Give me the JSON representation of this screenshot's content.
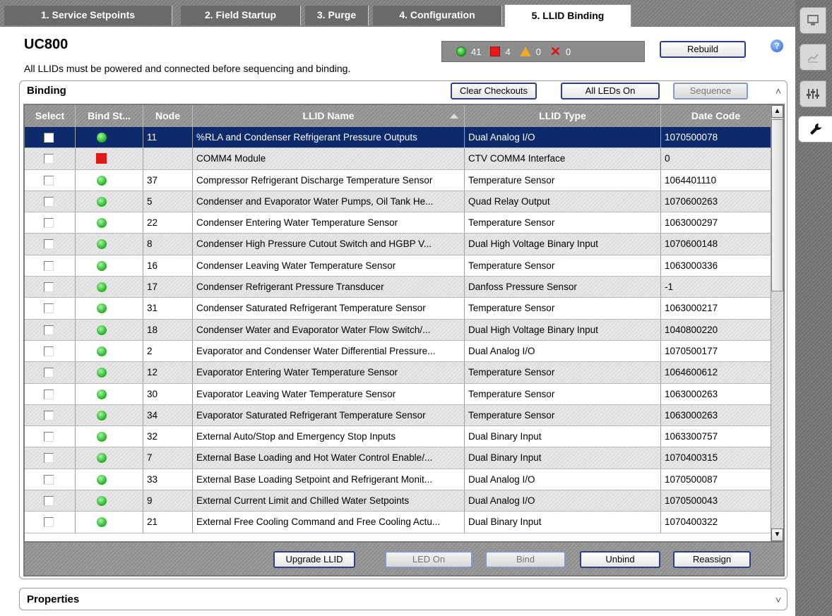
{
  "tabs": [
    {
      "label": "1. Service Setpoints"
    },
    {
      "label": "2. Field Startup"
    },
    {
      "label": "3. Purge"
    },
    {
      "label": "4. Configuration"
    },
    {
      "label": "5. LLID Binding"
    }
  ],
  "header": {
    "title": "UC800",
    "subtitle": "All LLIDs must be powered and connected before sequencing and binding.",
    "status": {
      "ok": "41",
      "error": "4",
      "warning": "0",
      "missing": "0"
    },
    "rebuild_label": "Rebuild",
    "help_glyph": "?"
  },
  "binding": {
    "title": "Binding",
    "collapse_glyph": "˄",
    "buttons": {
      "clear_checkouts": "Clear Checkouts",
      "all_leds_on": "All LEDs On",
      "sequence": "Sequence"
    },
    "columns": [
      "Select",
      "Bind St...",
      "Node",
      "LLID Name",
      "LLID Type",
      "Date Code"
    ],
    "rows": [
      {
        "status": "ok",
        "node": "11",
        "name": "%RLA and Condenser Refrigerant Pressure Outputs",
        "type": "Dual Analog I/O",
        "date": "1070500078",
        "selected": true
      },
      {
        "status": "error",
        "node": "",
        "name": "COMM4 Module",
        "type": "CTV COMM4 Interface",
        "date": "0"
      },
      {
        "status": "ok",
        "node": "37",
        "name": "Compressor Refrigerant Discharge Temperature Sensor",
        "type": "Temperature Sensor",
        "date": "1064401110"
      },
      {
        "status": "ok",
        "node": "5",
        "name": "Condenser and Evaporator Water Pumps, Oil Tank He...",
        "type": "Quad Relay Output",
        "date": "1070600263"
      },
      {
        "status": "ok",
        "node": "22",
        "name": "Condenser Entering Water Temperature Sensor",
        "type": "Temperature Sensor",
        "date": "1063000297"
      },
      {
        "status": "ok",
        "node": "8",
        "name": "Condenser High Pressure Cutout Switch and HGBP V...",
        "type": "Dual High Voltage Binary Input",
        "date": "1070600148"
      },
      {
        "status": "ok",
        "node": "16",
        "name": "Condenser Leaving Water Temperature Sensor",
        "type": "Temperature Sensor",
        "date": "1063000336"
      },
      {
        "status": "ok",
        "node": "17",
        "name": "Condenser Refrigerant Pressure Transducer",
        "type": "Danfoss Pressure Sensor",
        "date": "-1"
      },
      {
        "status": "ok",
        "node": "31",
        "name": "Condenser Saturated Refrigerant Temperature Sensor",
        "type": "Temperature Sensor",
        "date": "1063000217"
      },
      {
        "status": "ok",
        "node": "18",
        "name": "Condenser Water and Evaporator Water Flow Switch/...",
        "type": "Dual High Voltage Binary Input",
        "date": "1040800220"
      },
      {
        "status": "ok",
        "node": "2",
        "name": "Evaporator and Condenser Water Differential Pressure...",
        "type": "Dual Analog I/O",
        "date": "1070500177"
      },
      {
        "status": "ok",
        "node": "12",
        "name": "Evaporator Entering Water Temperature Sensor",
        "type": "Temperature Sensor",
        "date": "1064600612"
      },
      {
        "status": "ok",
        "node": "30",
        "name": "Evaporator Leaving Water Temperature Sensor",
        "type": "Temperature Sensor",
        "date": "1063000263"
      },
      {
        "status": "ok",
        "node": "34",
        "name": "Evaporator Saturated Refrigerant Temperature Sensor",
        "type": "Temperature Sensor",
        "date": "1063000263"
      },
      {
        "status": "ok",
        "node": "32",
        "name": "External Auto/Stop and Emergency Stop Inputs",
        "type": "Dual Binary Input",
        "date": "1063300757"
      },
      {
        "status": "ok",
        "node": "7",
        "name": "External Base Loading and Hot Water Control Enable/...",
        "type": "Dual Binary Input",
        "date": "1070400315"
      },
      {
        "status": "ok",
        "node": "33",
        "name": "External Base Loading Setpoint and Refrigerant Monit...",
        "type": "Dual Analog I/O",
        "date": "1070500087"
      },
      {
        "status": "ok",
        "node": "9",
        "name": "External Current Limit and Chilled Water Setpoints",
        "type": "Dual Analog I/O",
        "date": "1070500043"
      },
      {
        "status": "ok",
        "node": "21",
        "name": "External Free Cooling Command and Free Cooling Actu...",
        "type": "Dual Binary Input",
        "date": "1070400322"
      }
    ],
    "actions": {
      "upgrade": "Upgrade LLID",
      "led_on": "LED On",
      "bind": "Bind",
      "unbind": "Unbind",
      "reassign": "Reassign"
    }
  },
  "properties": {
    "title": "Properties",
    "expand_glyph": "˅"
  },
  "rail_icons": [
    "monitor-icon",
    "chart-icon",
    "settings-sliders-icon",
    "wrench-icon"
  ],
  "colors": {
    "selected_row": "#0d2a6c",
    "ok_led": "#31b931",
    "error_led": "#e01818",
    "warning": "#f0a830",
    "button_border": "#2e3d8a"
  }
}
